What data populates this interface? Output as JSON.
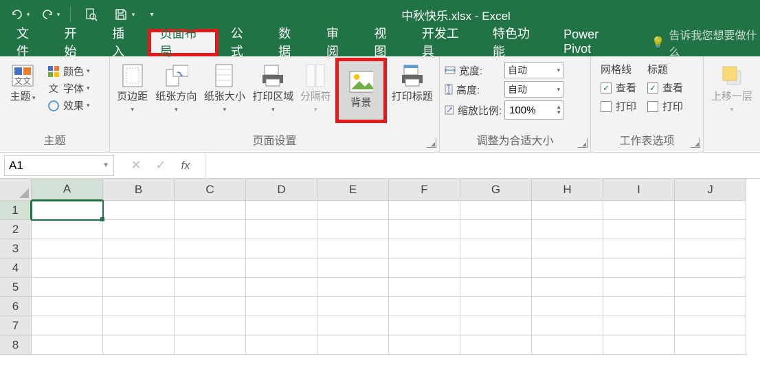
{
  "app": {
    "title": "中秋快乐.xlsx - Excel"
  },
  "qat": {
    "undo": "↶",
    "redo": "↷",
    "preview": "🔍",
    "save": "💾",
    "more": "▾"
  },
  "tabs": {
    "file": "文件",
    "home": "开始",
    "insert": "插入",
    "pagelayout": "页面布局",
    "formulas": "公式",
    "data": "数据",
    "review": "审阅",
    "view": "视图",
    "developer": "开发工具",
    "addins": "特色功能",
    "powerpivot": "Power Pivot",
    "tellme": "告诉我您想要做什么"
  },
  "ribbon": {
    "themes": {
      "title": "主题",
      "main": "主题",
      "colors": "颜色",
      "fonts": "字体",
      "effects": "效果"
    },
    "pagesetup": {
      "title": "页面设置",
      "margins": "页边距",
      "orientation": "纸张方向",
      "size": "纸张大小",
      "printarea": "打印区域",
      "breaks": "分隔符",
      "background": "背景",
      "titles": "打印标题"
    },
    "scale": {
      "title": "调整为合适大小",
      "width": "宽度:",
      "height": "高度:",
      "scale_label": "缩放比例:",
      "auto": "自动",
      "scale": "100%"
    },
    "sheetopts": {
      "title": "工作表选项",
      "gridlines": "网格线",
      "headings": "标题",
      "view": "查看",
      "print": "打印"
    },
    "arrange": {
      "bringfwd": "上移一层"
    }
  },
  "namebox": "A1",
  "grid": {
    "cols": [
      "A",
      "B",
      "C",
      "D",
      "E",
      "F",
      "G",
      "H",
      "I",
      "J"
    ],
    "rows": [
      "1",
      "2",
      "3",
      "4",
      "5",
      "6",
      "7",
      "8"
    ]
  }
}
